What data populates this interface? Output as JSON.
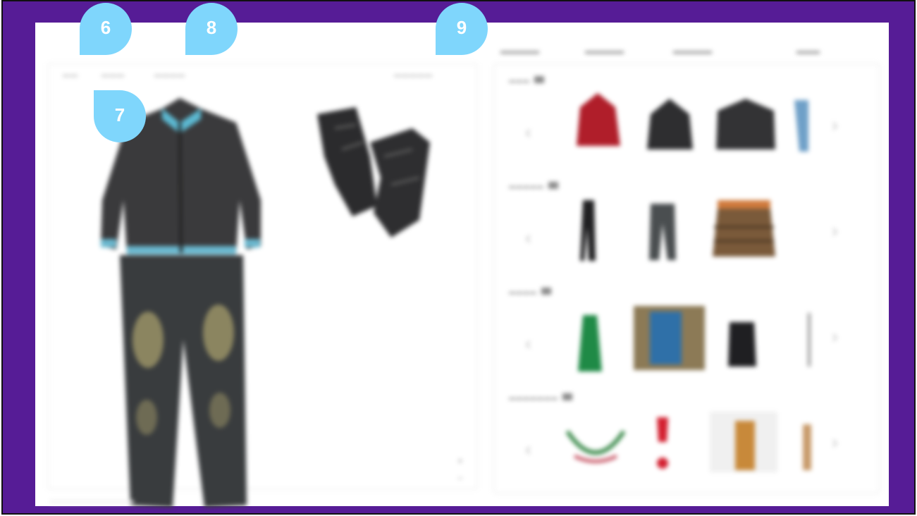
{
  "callouts": [
    {
      "number": "6"
    },
    {
      "number": "7"
    },
    {
      "number": "8"
    },
    {
      "number": "9"
    }
  ],
  "colors": {
    "frame": "#561c96",
    "callout": "#7fd6fc",
    "panel_border": "#e3e3e3"
  },
  "outfit_items": [
    {
      "icon": "jacket-icon"
    },
    {
      "icon": "jeans-icon"
    },
    {
      "icon": "gloves-icon"
    }
  ],
  "categories": [
    {
      "thumbnails": [
        "red-hoodie-icon",
        "dark-hoodie-icon",
        "dark-jacket-icon",
        "blue-partial-icon"
      ]
    },
    {
      "thumbnails": [
        "black-pants-icon",
        "grey-jeans-icon",
        "brown-skirt-icon"
      ]
    },
    {
      "thumbnails": [
        "green-shoe-icon",
        "blue-shoe-box-icon",
        "black-boot-icon",
        "thin-item-icon"
      ]
    },
    {
      "thumbnails": [
        "necklace-icon",
        "red-pendant-icon",
        "tan-bag-icon",
        "partial-item-icon"
      ]
    }
  ]
}
